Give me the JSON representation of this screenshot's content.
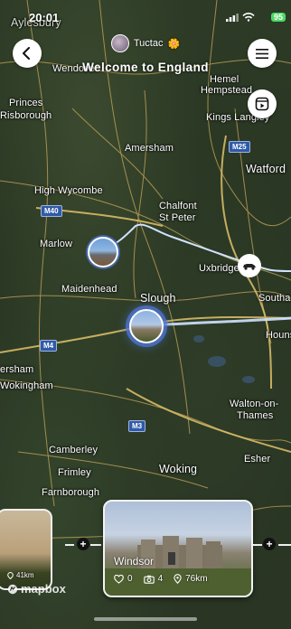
{
  "status_bar": {
    "time": "20:01",
    "battery": "95"
  },
  "header": {
    "username": "Tuctac",
    "user_emoji": "🌼",
    "title": "Welcome to England"
  },
  "map": {
    "places": [
      "Aylesbury",
      "Wendover",
      "Hemel",
      "Hempstead",
      "Princes",
      "Risborough",
      "Kings Langley",
      "Amersham",
      "Watford",
      "High Wycombe",
      "Chalfont",
      "St Peter",
      "Marlow",
      "Uxbridge",
      "Maidenhead",
      "Slough",
      "Southa",
      "Houns",
      "ersham",
      "Wokingham",
      "Walton-on-",
      "Thames",
      "Camberley",
      "Esher",
      "Frimley",
      "Woking",
      "Farnborough"
    ],
    "roads": [
      "M25",
      "M40",
      "M4",
      "M3"
    ]
  },
  "cards": {
    "main": {
      "name": "Windsor",
      "likes": "0",
      "photos": "4",
      "distance": "76km"
    },
    "side": {
      "distance": "41km"
    }
  },
  "attribution": "mapbox"
}
